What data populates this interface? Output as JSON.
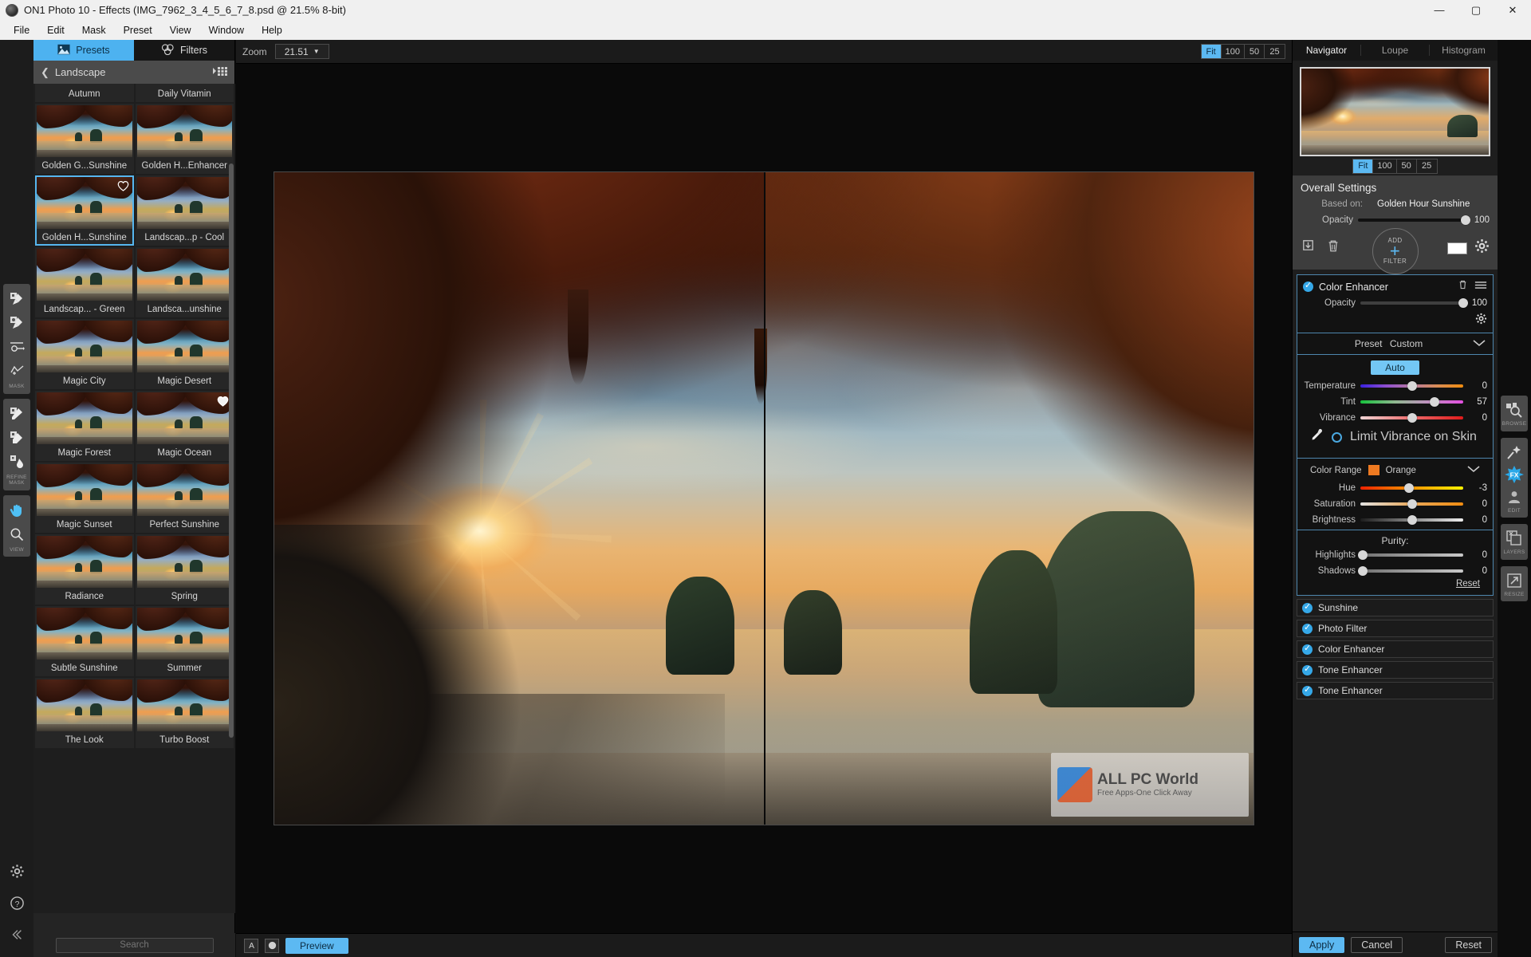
{
  "window": {
    "title": "ON1 Photo 10 - Effects (IMG_7962_3_4_5_6_7_8.psd @ 21.5% 8-bit)",
    "minimize": "—",
    "maximize": "▢",
    "close": "✕"
  },
  "menu": {
    "items": [
      "File",
      "Edit",
      "Mask",
      "Preset",
      "View",
      "Window",
      "Help"
    ]
  },
  "left_tools": {
    "groups": [
      {
        "label": "MASK",
        "tools": [
          "masking-brush-icon",
          "perfect-brush-icon",
          "masking-bug-icon",
          "quick-mask-icon"
        ]
      },
      {
        "label": "REFINE MASK",
        "tools": [
          "refine-brush-icon",
          "chisel-brush-icon",
          "blur-brush-icon"
        ]
      }
    ],
    "view_label": "VIEW",
    "view_tools": [
      "hand-tool-icon",
      "zoom-tool-icon"
    ],
    "bottom_tools": [
      "settings-gear-icon",
      "help-icon",
      "collapse-icon"
    ]
  },
  "presets_panel": {
    "tabs": [
      {
        "label": "Presets",
        "icon": "image-icon",
        "active": true
      },
      {
        "label": "Filters",
        "icon": "filters-icon",
        "active": false
      }
    ],
    "breadcrumb": {
      "back_icon": "chevron-left-icon",
      "label": "Landscape",
      "view_icon": "grid-view-icon"
    },
    "search_placeholder": "Search",
    "items": [
      {
        "label": "Autumn",
        "selected": false,
        "favorite": false,
        "partial": true,
        "tone": "warm"
      },
      {
        "label": "Daily Vitamin",
        "selected": false,
        "favorite": false,
        "partial": true,
        "tone": "warm"
      },
      {
        "label": "Golden G...Sunshine",
        "selected": false,
        "favorite": false,
        "tone": "warm"
      },
      {
        "label": "Golden H...Enhancer",
        "selected": false,
        "favorite": false,
        "tone": "warm"
      },
      {
        "label": "Golden H...Sunshine",
        "selected": true,
        "favorite": true,
        "tone": "warm"
      },
      {
        "label": "Landscap...p - Cool",
        "selected": false,
        "favorite": false,
        "tone": "cool"
      },
      {
        "label": "Landscap... - Green",
        "selected": false,
        "favorite": false,
        "tone": "cool"
      },
      {
        "label": "Landsca...unshine",
        "selected": false,
        "favorite": false,
        "tone": "warm"
      },
      {
        "label": "Magic City",
        "selected": false,
        "favorite": false,
        "tone": "cool"
      },
      {
        "label": "Magic Desert",
        "selected": false,
        "favorite": false,
        "tone": "warm"
      },
      {
        "label": "Magic Forest",
        "selected": false,
        "favorite": false,
        "tone": "cool"
      },
      {
        "label": "Magic Ocean",
        "selected": false,
        "favorite": true,
        "tone": "cool"
      },
      {
        "label": "Magic Sunset",
        "selected": false,
        "favorite": false,
        "tone": "warm"
      },
      {
        "label": "Perfect Sunshine",
        "selected": false,
        "favorite": false,
        "tone": "warm"
      },
      {
        "label": "Radiance",
        "selected": false,
        "favorite": false,
        "tone": "warm"
      },
      {
        "label": "Spring",
        "selected": false,
        "favorite": false,
        "tone": "cool"
      },
      {
        "label": "Subtle Sunshine",
        "selected": false,
        "favorite": false,
        "tone": "warm"
      },
      {
        "label": "Summer",
        "selected": false,
        "favorite": false,
        "tone": "warm"
      },
      {
        "label": "The Look",
        "selected": false,
        "favorite": false,
        "tone": "cool"
      },
      {
        "label": "Turbo Boost",
        "selected": false,
        "favorite": false,
        "tone": "warm"
      }
    ]
  },
  "canvas_toolbar": {
    "zoom_label": "Zoom",
    "zoom_value": "21.51",
    "zoom_caret": "▼",
    "fit_buttons": [
      {
        "label": "Fit",
        "active": true
      },
      {
        "label": "100",
        "active": false
      },
      {
        "label": "50",
        "active": false
      },
      {
        "label": "25",
        "active": false
      }
    ]
  },
  "canvas_footer": {
    "compare_icon": "compare-a-icon",
    "mask_view_icon": "mask-view-icon",
    "preview_label": "Preview"
  },
  "watermark": {
    "line1": "ALL PC World",
    "line2": "Free Apps-One Click Away"
  },
  "navigator": {
    "tabs": [
      {
        "label": "Navigator",
        "active": true
      },
      {
        "label": "Loupe",
        "active": false
      },
      {
        "label": "Histogram",
        "active": false
      }
    ],
    "fit_buttons": [
      {
        "label": "Fit",
        "active": true
      },
      {
        "label": "100",
        "active": false
      },
      {
        "label": "50",
        "active": false
      },
      {
        "label": "25",
        "active": false
      }
    ]
  },
  "overall_settings": {
    "title": "Overall Settings",
    "based_on_label": "Based on:",
    "based_on_value": "Golden Hour Sunshine",
    "opacity_label": "Opacity",
    "opacity_value": "100",
    "save_icon": "save-preset-icon",
    "delete_icon": "trash-icon",
    "add_filter_top": "ADD",
    "add_filter_plus": "+",
    "add_filter_bottom": "FILTER",
    "swatch_color": "#ffffff",
    "gear_icon": "gear-icon"
  },
  "color_enhancer": {
    "title": "Color Enhancer",
    "enabled": true,
    "delete_icon": "trash-icon",
    "menu_icon": "hamburger-menu-icon",
    "opacity_label": "Opacity",
    "opacity_value": "100",
    "gear_icon": "gear-icon",
    "preset_label": "Preset",
    "preset_value": "Custom",
    "preset_caret": "chevron-down-icon",
    "auto_label": "Auto",
    "sliders": [
      {
        "label": "Temperature",
        "value": "0",
        "pos": 50,
        "grad": "grad-temp"
      },
      {
        "label": "Tint",
        "value": "57",
        "pos": 72,
        "grad": "grad-tint"
      },
      {
        "label": "Vibrance",
        "value": "0",
        "pos": 50,
        "grad": "grad-vib"
      }
    ],
    "eyedropper_icon": "eyedropper-icon",
    "limit_vibrance_label": "Limit Vibrance on Skin",
    "limit_vibrance_checked": false,
    "color_range_label": "Color Range",
    "color_range_value": "Orange",
    "color_range_swatch": "#ef7a21",
    "color_range_caret": "chevron-down-icon",
    "range_sliders": [
      {
        "label": "Hue",
        "value": "-3",
        "pos": 47,
        "grad": "grad-hue"
      },
      {
        "label": "Saturation",
        "value": "0",
        "pos": 50,
        "grad": "grad-sat"
      },
      {
        "label": "Brightness",
        "value": "0",
        "pos": 50,
        "grad": "grad-bri"
      }
    ],
    "purity_label": "Purity:",
    "purity_sliders": [
      {
        "label": "Highlights",
        "value": "0",
        "pos": 2,
        "grad": "grad-gray"
      },
      {
        "label": "Shadows",
        "value": "0",
        "pos": 2,
        "grad": "grad-gray"
      }
    ],
    "reset_label": "Reset"
  },
  "filter_stack": [
    {
      "label": "Sunshine",
      "enabled": true
    },
    {
      "label": "Photo Filter",
      "enabled": true
    },
    {
      "label": "Color Enhancer",
      "enabled": true
    },
    {
      "label": "Tone Enhancer",
      "enabled": true
    },
    {
      "label": "Tone Enhancer",
      "enabled": true
    }
  ],
  "right_footer": {
    "apply_label": "Apply",
    "cancel_label": "Cancel",
    "reset_label": "Reset"
  },
  "module_rail": {
    "groups": [
      {
        "label": "BROWSE",
        "items": [
          "browse-icon"
        ]
      },
      {
        "label": "EDIT",
        "items": [
          "enhance-icon",
          "fx-icon",
          "portrait-icon"
        ],
        "fx_text": "FX"
      },
      {
        "label": "LAYERS",
        "items": [
          "layers-icon"
        ]
      },
      {
        "label": "RESIZE",
        "items": [
          "resize-icon"
        ]
      }
    ]
  }
}
